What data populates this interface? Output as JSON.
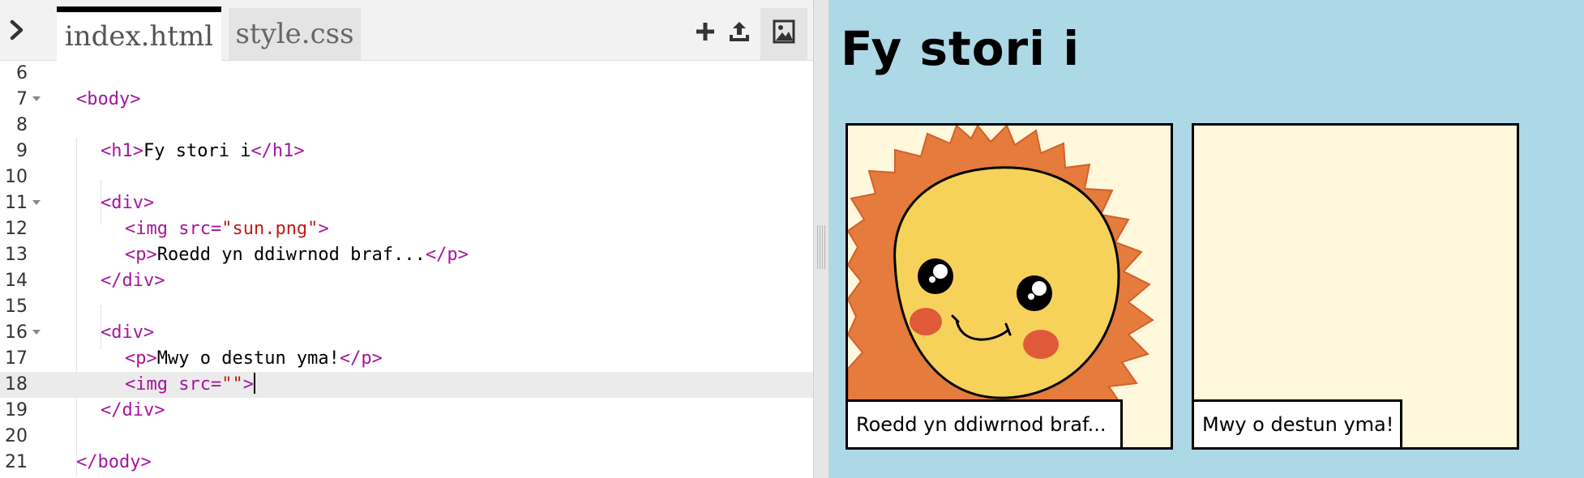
{
  "tabs": [
    {
      "label": "index.html",
      "active": true
    },
    {
      "label": "style.css",
      "active": false
    }
  ],
  "toolbar": {
    "expand_icon": "chevron-right-icon",
    "add_icon": "plus-icon",
    "upload_icon": "upload-icon",
    "image_icon": "image-icon"
  },
  "editor": {
    "lines": [
      {
        "n": "6",
        "segments": []
      },
      {
        "n": "7",
        "fold": true,
        "segments": [
          {
            "t": "tag",
            "v": "<body>"
          }
        ]
      },
      {
        "n": "8",
        "segments": []
      },
      {
        "n": "9",
        "segments": [
          {
            "t": "tag",
            "v": "<h1>"
          },
          {
            "t": "txt",
            "v": "Fy stori i"
          },
          {
            "t": "tag",
            "v": "</h1>"
          }
        ]
      },
      {
        "n": "10",
        "segments": []
      },
      {
        "n": "11",
        "fold": true,
        "segments": [
          {
            "t": "tag",
            "v": "<div>"
          }
        ]
      },
      {
        "n": "12",
        "segments": [
          {
            "t": "tag",
            "v": "<img "
          },
          {
            "t": "attr",
            "v": "src="
          },
          {
            "t": "str",
            "v": "\"sun.png\""
          },
          {
            "t": "tag",
            "v": ">"
          }
        ]
      },
      {
        "n": "13",
        "segments": [
          {
            "t": "tag",
            "v": "<p>"
          },
          {
            "t": "txt",
            "v": "Roedd yn ddiwrnod braf..."
          },
          {
            "t": "tag",
            "v": "</p>"
          }
        ]
      },
      {
        "n": "14",
        "segments": [
          {
            "t": "tag",
            "v": "</div>"
          }
        ]
      },
      {
        "n": "15",
        "segments": []
      },
      {
        "n": "16",
        "fold": true,
        "segments": [
          {
            "t": "tag",
            "v": "<div>"
          }
        ]
      },
      {
        "n": "17",
        "segments": [
          {
            "t": "tag",
            "v": "<p>"
          },
          {
            "t": "txt",
            "v": "Mwy o destun yma!"
          },
          {
            "t": "tag",
            "v": "</p>"
          }
        ]
      },
      {
        "n": "18",
        "current": true,
        "segments": [
          {
            "t": "tag",
            "v": "<img "
          },
          {
            "t": "attr",
            "v": "src="
          },
          {
            "t": "str",
            "v": "\"\""
          },
          {
            "t": "tag",
            "v": ">"
          }
        ]
      },
      {
        "n": "19",
        "segments": [
          {
            "t": "tag",
            "v": "</div>"
          }
        ]
      },
      {
        "n": "20",
        "segments": []
      },
      {
        "n": "21",
        "segments": [
          {
            "t": "tag",
            "v": "</body>"
          }
        ]
      }
    ],
    "colors": {
      "tag": "#a5169d",
      "string": "#c41a16",
      "text": "#000000"
    }
  },
  "preview": {
    "title": "Fy stori i",
    "panels": [
      {
        "caption": "Roedd yn ddiwrnod braf...",
        "image": "sun-icon"
      },
      {
        "caption": "Mwy o destun yma!"
      }
    ],
    "colors": {
      "background": "#add8e6",
      "panel": "#fff8dc"
    }
  }
}
